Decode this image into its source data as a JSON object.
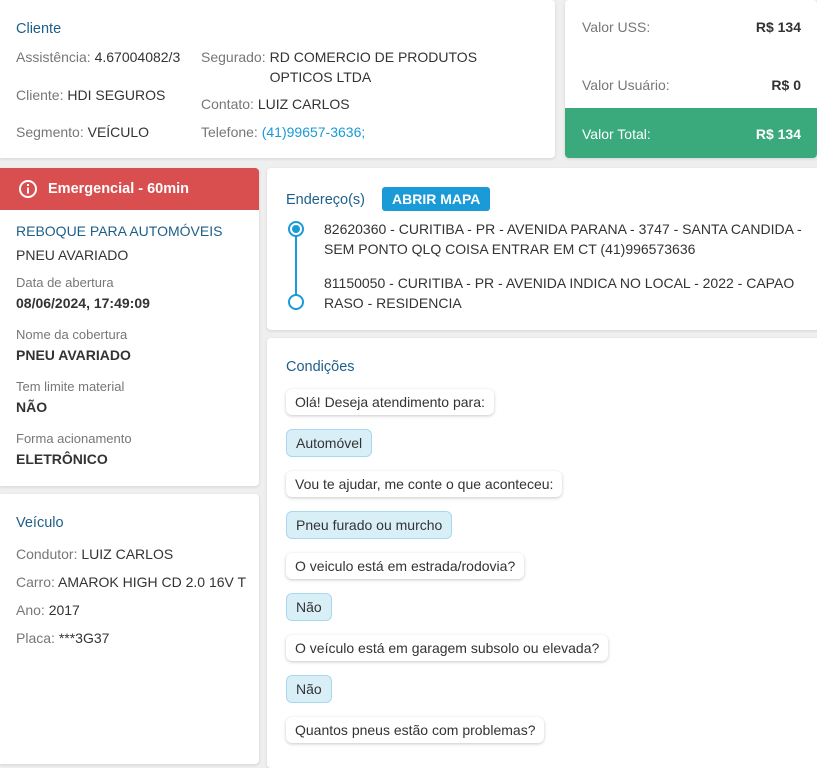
{
  "cliente": {
    "title": "Cliente",
    "assistencia_label": "Assistência:",
    "assistencia": "4.67004082/3",
    "cliente_label": "Cliente:",
    "cliente": "HDI SEGUROS",
    "segmento_label": "Segmento:",
    "segmento": "VEÍCULO",
    "segurado_label": "Segurado:",
    "segurado": "RD COMERCIO DE PRODUTOS OPTICOS LTDA",
    "contato_label": "Contato:",
    "contato": "LUIZ CARLOS",
    "telefone_label": "Telefone:",
    "telefone": "(41)99657-3636;"
  },
  "valores": {
    "uss_label": "Valor USS:",
    "uss": "R$ 134",
    "usuario_label": "Valor Usuário:",
    "usuario": "R$ 0",
    "total_label": "Valor Total:",
    "total": "R$ 134",
    "total_color": "#3aa97c"
  },
  "servico": {
    "badge": "Emergencial - 60min",
    "badge_icon": "info-icon",
    "badge_color": "#d94f4f",
    "tipo": "REBOQUE PARA AUTOMÓVEIS",
    "motivo": "PNEU AVARIADO",
    "fields": [
      {
        "label": "Data de abertura",
        "value": "08/06/2024, 17:49:09"
      },
      {
        "label": "Nome da cobertura",
        "value": "PNEU AVARIADO"
      },
      {
        "label": "Tem limite material",
        "value": "NÃO"
      },
      {
        "label": "Forma acionamento",
        "value": "ELETRÔNICO"
      }
    ]
  },
  "veiculo": {
    "title": "Veículo",
    "condutor_label": "Condutor:",
    "condutor": "LUIZ CARLOS",
    "carro_label": "Carro:",
    "carro": "AMAROK HIGH CD 2.0 16V T",
    "ano_label": "Ano:",
    "ano": "2017",
    "placa_label": "Placa:",
    "placa": "***3G37"
  },
  "enderecos": {
    "title": "Endereço(s)",
    "map_button": "ABRIR MAPA",
    "items": [
      "82620360 - CURITIBA - PR - AVENIDA PARANA - 3747 - SANTA CANDIDA - SEM PONTO QLQ COISA ENTRAR EM CT (41)996573636",
      "81150050 - CURITIBA - PR - AVENIDA INDICA NO LOCAL - 2022 - CAPAO RASO - RESIDENCIA"
    ]
  },
  "condicoes": {
    "title": "Condições",
    "messages": [
      {
        "text": "Olá! Deseja atendimento para:",
        "answer": false
      },
      {
        "text": "Automóvel",
        "answer": true
      },
      {
        "text": "Vou te ajudar, me conte o que aconteceu:",
        "answer": false
      },
      {
        "text": "Pneu furado ou murcho",
        "answer": true
      },
      {
        "text": "O veiculo está em estrada/rodovia?",
        "answer": false
      },
      {
        "text": "Não",
        "answer": true
      },
      {
        "text": "O veículo está em garagem subsolo ou elevada?",
        "answer": false
      },
      {
        "text": "Não",
        "answer": true
      },
      {
        "text": "Quantos pneus estão com problemas?",
        "answer": false
      }
    ]
  }
}
